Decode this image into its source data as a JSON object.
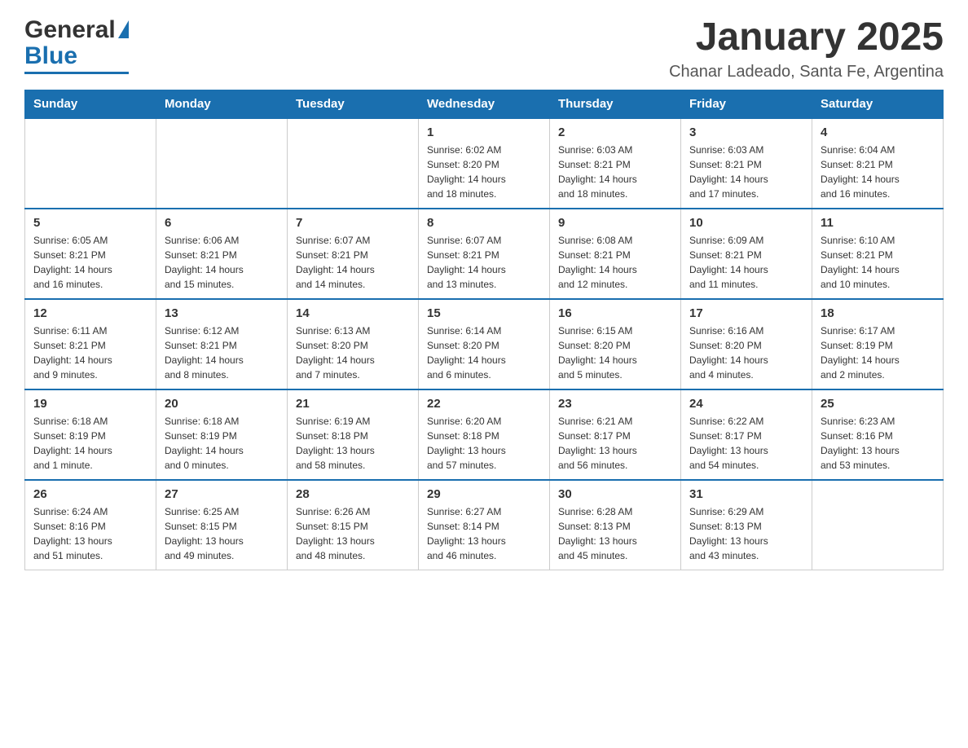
{
  "header": {
    "logo_general": "General",
    "logo_blue": "Blue",
    "month_year": "January 2025",
    "location": "Chanar Ladeado, Santa Fe, Argentina"
  },
  "days_of_week": [
    "Sunday",
    "Monday",
    "Tuesday",
    "Wednesday",
    "Thursday",
    "Friday",
    "Saturday"
  ],
  "weeks": [
    [
      {
        "day": "",
        "info": ""
      },
      {
        "day": "",
        "info": ""
      },
      {
        "day": "",
        "info": ""
      },
      {
        "day": "1",
        "info": "Sunrise: 6:02 AM\nSunset: 8:20 PM\nDaylight: 14 hours\nand 18 minutes."
      },
      {
        "day": "2",
        "info": "Sunrise: 6:03 AM\nSunset: 8:21 PM\nDaylight: 14 hours\nand 18 minutes."
      },
      {
        "day": "3",
        "info": "Sunrise: 6:03 AM\nSunset: 8:21 PM\nDaylight: 14 hours\nand 17 minutes."
      },
      {
        "day": "4",
        "info": "Sunrise: 6:04 AM\nSunset: 8:21 PM\nDaylight: 14 hours\nand 16 minutes."
      }
    ],
    [
      {
        "day": "5",
        "info": "Sunrise: 6:05 AM\nSunset: 8:21 PM\nDaylight: 14 hours\nand 16 minutes."
      },
      {
        "day": "6",
        "info": "Sunrise: 6:06 AM\nSunset: 8:21 PM\nDaylight: 14 hours\nand 15 minutes."
      },
      {
        "day": "7",
        "info": "Sunrise: 6:07 AM\nSunset: 8:21 PM\nDaylight: 14 hours\nand 14 minutes."
      },
      {
        "day": "8",
        "info": "Sunrise: 6:07 AM\nSunset: 8:21 PM\nDaylight: 14 hours\nand 13 minutes."
      },
      {
        "day": "9",
        "info": "Sunrise: 6:08 AM\nSunset: 8:21 PM\nDaylight: 14 hours\nand 12 minutes."
      },
      {
        "day": "10",
        "info": "Sunrise: 6:09 AM\nSunset: 8:21 PM\nDaylight: 14 hours\nand 11 minutes."
      },
      {
        "day": "11",
        "info": "Sunrise: 6:10 AM\nSunset: 8:21 PM\nDaylight: 14 hours\nand 10 minutes."
      }
    ],
    [
      {
        "day": "12",
        "info": "Sunrise: 6:11 AM\nSunset: 8:21 PM\nDaylight: 14 hours\nand 9 minutes."
      },
      {
        "day": "13",
        "info": "Sunrise: 6:12 AM\nSunset: 8:21 PM\nDaylight: 14 hours\nand 8 minutes."
      },
      {
        "day": "14",
        "info": "Sunrise: 6:13 AM\nSunset: 8:20 PM\nDaylight: 14 hours\nand 7 minutes."
      },
      {
        "day": "15",
        "info": "Sunrise: 6:14 AM\nSunset: 8:20 PM\nDaylight: 14 hours\nand 6 minutes."
      },
      {
        "day": "16",
        "info": "Sunrise: 6:15 AM\nSunset: 8:20 PM\nDaylight: 14 hours\nand 5 minutes."
      },
      {
        "day": "17",
        "info": "Sunrise: 6:16 AM\nSunset: 8:20 PM\nDaylight: 14 hours\nand 4 minutes."
      },
      {
        "day": "18",
        "info": "Sunrise: 6:17 AM\nSunset: 8:19 PM\nDaylight: 14 hours\nand 2 minutes."
      }
    ],
    [
      {
        "day": "19",
        "info": "Sunrise: 6:18 AM\nSunset: 8:19 PM\nDaylight: 14 hours\nand 1 minute."
      },
      {
        "day": "20",
        "info": "Sunrise: 6:18 AM\nSunset: 8:19 PM\nDaylight: 14 hours\nand 0 minutes."
      },
      {
        "day": "21",
        "info": "Sunrise: 6:19 AM\nSunset: 8:18 PM\nDaylight: 13 hours\nand 58 minutes."
      },
      {
        "day": "22",
        "info": "Sunrise: 6:20 AM\nSunset: 8:18 PM\nDaylight: 13 hours\nand 57 minutes."
      },
      {
        "day": "23",
        "info": "Sunrise: 6:21 AM\nSunset: 8:17 PM\nDaylight: 13 hours\nand 56 minutes."
      },
      {
        "day": "24",
        "info": "Sunrise: 6:22 AM\nSunset: 8:17 PM\nDaylight: 13 hours\nand 54 minutes."
      },
      {
        "day": "25",
        "info": "Sunrise: 6:23 AM\nSunset: 8:16 PM\nDaylight: 13 hours\nand 53 minutes."
      }
    ],
    [
      {
        "day": "26",
        "info": "Sunrise: 6:24 AM\nSunset: 8:16 PM\nDaylight: 13 hours\nand 51 minutes."
      },
      {
        "day": "27",
        "info": "Sunrise: 6:25 AM\nSunset: 8:15 PM\nDaylight: 13 hours\nand 49 minutes."
      },
      {
        "day": "28",
        "info": "Sunrise: 6:26 AM\nSunset: 8:15 PM\nDaylight: 13 hours\nand 48 minutes."
      },
      {
        "day": "29",
        "info": "Sunrise: 6:27 AM\nSunset: 8:14 PM\nDaylight: 13 hours\nand 46 minutes."
      },
      {
        "day": "30",
        "info": "Sunrise: 6:28 AM\nSunset: 8:13 PM\nDaylight: 13 hours\nand 45 minutes."
      },
      {
        "day": "31",
        "info": "Sunrise: 6:29 AM\nSunset: 8:13 PM\nDaylight: 13 hours\nand 43 minutes."
      },
      {
        "day": "",
        "info": ""
      }
    ]
  ]
}
